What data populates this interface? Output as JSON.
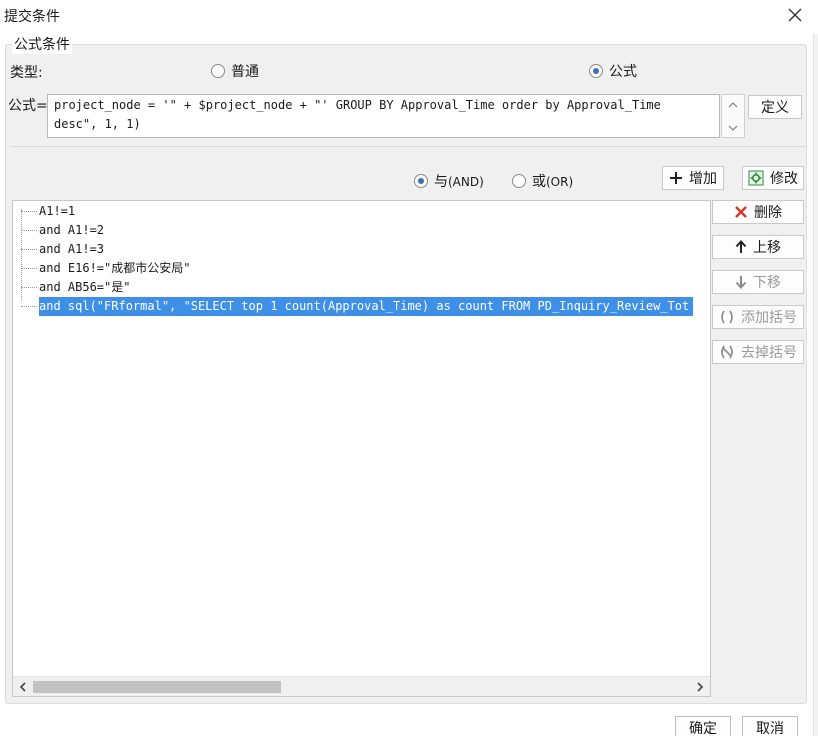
{
  "window": {
    "title": "提交条件"
  },
  "group": {
    "legend": "公式条件"
  },
  "type_row": {
    "label": "类型:",
    "options": [
      {
        "label": "普通",
        "selected": false
      },
      {
        "label": "公式",
        "selected": true
      }
    ]
  },
  "formula": {
    "label": "公式=",
    "value": "project_node = '\" + $project_node + \"' GROUP BY Approval_Time order by Approval_Time\ndesc\", 1, 1)",
    "define_label": "定义"
  },
  "logic": {
    "and_label": "与",
    "and_sub": "(AND)",
    "or_label": "或",
    "or_sub": "(OR)",
    "selected": "and"
  },
  "actions": {
    "add": "增加",
    "modify": "修改",
    "delete": "删除",
    "move_up": "上移",
    "move_down": "下移",
    "add_brackets": "添加括号",
    "remove_brackets": "去掉括号"
  },
  "conditions": [
    {
      "text": "A1!=1",
      "selected": false
    },
    {
      "text": "and A1!=2",
      "selected": false
    },
    {
      "text": "and A1!=3",
      "selected": false
    },
    {
      "text": "and E16!=\"成都市公安局\"",
      "selected": false
    },
    {
      "text": "and AB56=\"是\"",
      "selected": false
    },
    {
      "text": "and sql(\"FRformal\", \"SELECT top 1 count(Approval_Time) as count FROM PD_Inquiry_Review_Tot",
      "selected": true
    }
  ],
  "footer": {
    "ok": "确定",
    "cancel": "取消"
  },
  "colors": {
    "selection": "#3d8fe8",
    "radio_dot": "#3b6fb6",
    "delete_icon": "#d9342b",
    "modify_icon": "#2e8b3a"
  }
}
